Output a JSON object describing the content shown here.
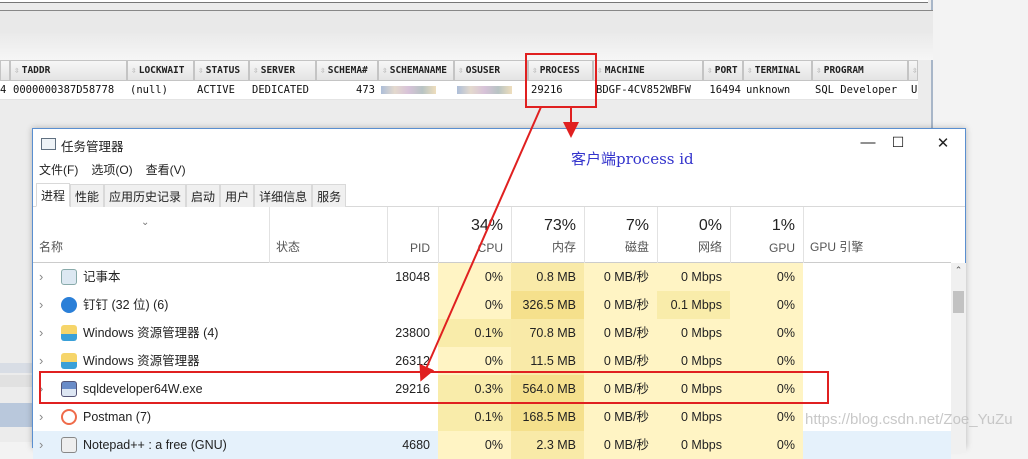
{
  "sql_grid": {
    "lead_cell": "4",
    "columns": [
      "TADDR",
      "LOCKWAIT",
      "STATUS",
      "SERVER",
      "SCHEMA#",
      "SCHEMANAME",
      "OSUSER",
      "PROCESS",
      "MACHINE",
      "PORT",
      "TERMINAL",
      "PROGRAM",
      ""
    ],
    "row": [
      "0000000387D58778",
      "(null)",
      "ACTIVE",
      "DEDICATED",
      "473",
      "",
      "",
      "29216",
      "BDGF-4CV852WBFW",
      "16494",
      "unknown",
      "SQL Developer",
      "U"
    ]
  },
  "annotation": "客户端process id",
  "task_manager": {
    "title": "任务管理器",
    "menu": [
      "文件(F)",
      "选项(O)",
      "查看(V)"
    ],
    "tabs": [
      "进程",
      "性能",
      "应用历史记录",
      "启动",
      "用户",
      "详细信息",
      "服务"
    ],
    "headers": {
      "name": "名称",
      "status": "状态",
      "pid": "PID",
      "cpu": "CPU",
      "cpu_pct": "34%",
      "memory": "内存",
      "memory_pct": "73%",
      "disk": "磁盘",
      "disk_pct": "7%",
      "network": "网络",
      "network_pct": "0%",
      "gpu": "GPU",
      "gpu_pct": "1%",
      "gpu_engine": "GPU 引擎"
    },
    "processes": [
      {
        "name": "记事本",
        "icon": "notepad-icon",
        "pid": "18048",
        "cpu": "0%",
        "memory": "0.8 MB",
        "disk": "0 MB/秒",
        "network": "0 Mbps",
        "gpu": "0%"
      },
      {
        "name": "钉钉 (32 位) (6)",
        "icon": "dingtalk-icon",
        "pid": "",
        "cpu": "0%",
        "memory": "326.5 MB",
        "disk": "0 MB/秒",
        "network": "0.1 Mbps",
        "gpu": "0%"
      },
      {
        "name": "Windows 资源管理器 (4)",
        "icon": "folder-icon",
        "pid": "23800",
        "cpu": "0.1%",
        "memory": "70.8 MB",
        "disk": "0 MB/秒",
        "network": "0 Mbps",
        "gpu": "0%"
      },
      {
        "name": "Windows 资源管理器",
        "icon": "folder-icon",
        "pid": "26312",
        "cpu": "0%",
        "memory": "11.5 MB",
        "disk": "0 MB/秒",
        "network": "0 Mbps",
        "gpu": "0%"
      },
      {
        "name": "sqldeveloper64W.exe",
        "icon": "sqldeveloper-icon",
        "pid": "29216",
        "cpu": "0.3%",
        "memory": "564.0 MB",
        "disk": "0 MB/秒",
        "network": "0 Mbps",
        "gpu": "0%"
      },
      {
        "name": "Postman (7)",
        "icon": "postman-icon",
        "pid": "",
        "cpu": "0.1%",
        "memory": "168.5 MB",
        "disk": "0 MB/秒",
        "network": "0 Mbps",
        "gpu": "0%"
      },
      {
        "name": "Notepad++ : a free (GNU)",
        "icon": "notepadpp-icon",
        "pid": "4680",
        "cpu": "0%",
        "memory": "2.3 MB",
        "disk": "0 MB/秒",
        "network": "0 Mbps",
        "gpu": "0%"
      }
    ]
  },
  "watermark": "https://blog.csdn.net/Zoe_YuZu",
  "colors": {
    "highlight": "#e02020",
    "annotation": "#3333cc"
  }
}
